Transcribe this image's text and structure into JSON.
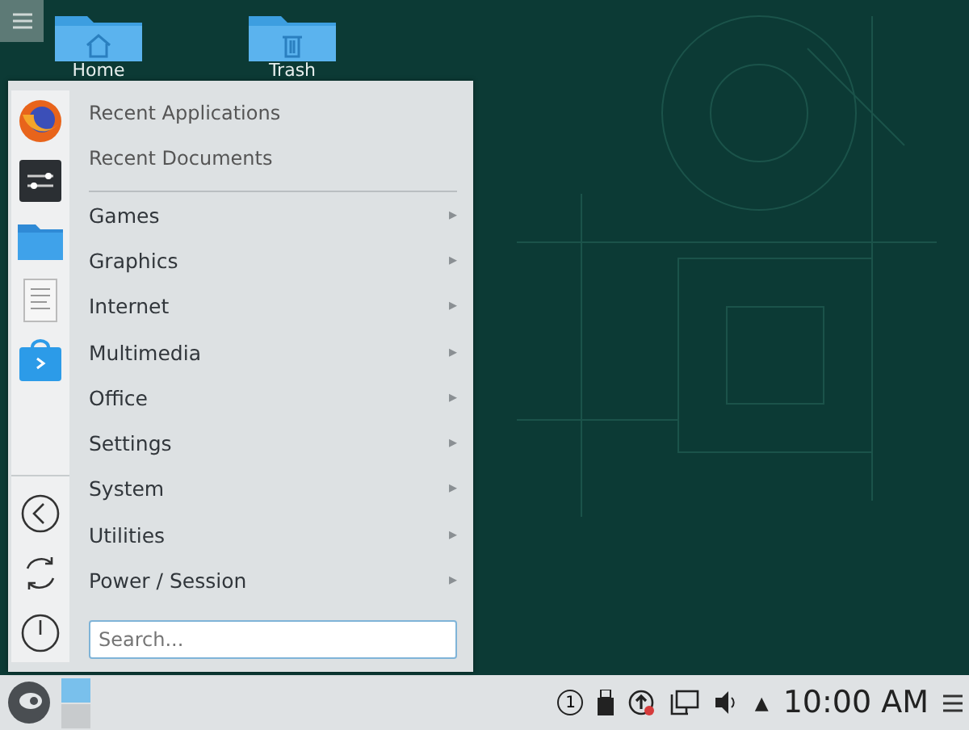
{
  "desktop_icons": [
    {
      "label": "Home",
      "kind": "home"
    },
    {
      "label": "Trash",
      "kind": "trash"
    }
  ],
  "menu": {
    "favorites": [
      {
        "kind": "firefox"
      },
      {
        "kind": "settings"
      },
      {
        "kind": "folder"
      },
      {
        "kind": "document"
      },
      {
        "kind": "store"
      }
    ],
    "actions": [
      {
        "kind": "back"
      },
      {
        "kind": "switch"
      },
      {
        "kind": "power"
      }
    ],
    "recent": [
      "Recent Applications",
      "Recent Documents"
    ],
    "categories": [
      {
        "label": "Games",
        "arrow": "▸"
      },
      {
        "label": "Graphics",
        "arrow": "▸"
      },
      {
        "label": "Internet",
        "arrow": "▸"
      },
      {
        "label": "Multimedia",
        "arrow": "▸"
      },
      {
        "label": "Office",
        "arrow": "▸"
      },
      {
        "label": "Settings",
        "arrow": "▸"
      },
      {
        "label": "System",
        "arrow": "▸"
      },
      {
        "label": "Utilities",
        "arrow": "▸"
      },
      {
        "label": "Power / Session",
        "arrow": "▸"
      }
    ],
    "search": {
      "placeholder": "Search..."
    }
  },
  "taskbar": {
    "pager": [
      {
        "selected": true
      },
      {
        "selected": false
      }
    ],
    "tray": [
      {
        "kind": "notifications",
        "text": "1"
      },
      {
        "kind": "usb"
      },
      {
        "kind": "updates"
      },
      {
        "kind": "network"
      },
      {
        "kind": "volume"
      }
    ],
    "expand": "▲",
    "clock": "10:00 AM"
  }
}
